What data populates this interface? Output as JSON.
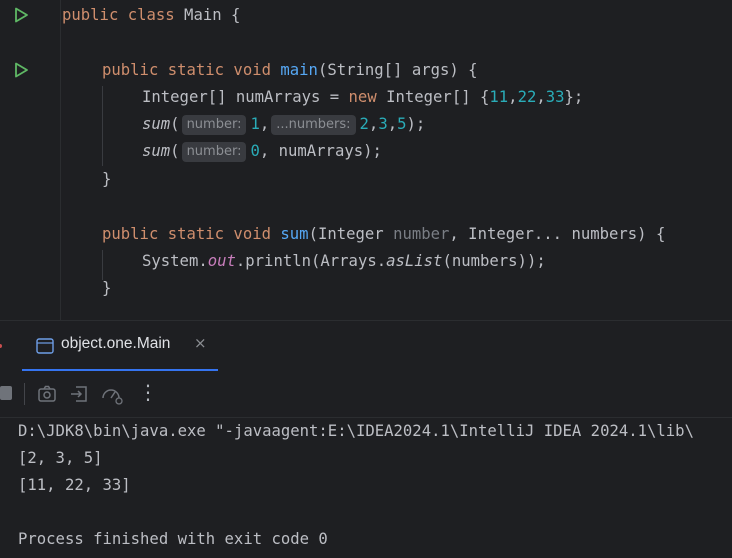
{
  "editor": {
    "line1": {
      "kw": "public class",
      "rest": " Main {"
    },
    "line3": {
      "kw": "public static void",
      "name": "main",
      "rest": "(String[] args) {"
    },
    "line4": {
      "a": "Integer[] numArrays = ",
      "kw": "new",
      "b": " Integer[] {",
      "n1": "11",
      "c1": ",",
      "n2": "22",
      "c2": ",",
      "n3": "33",
      "end": "};"
    },
    "line5": {
      "call": "sum",
      "open": "(",
      "hint1": "number:",
      "v1": "1",
      "comma": ",",
      "hint2": "...numbers:",
      "v2": "2",
      "c1": ",",
      "v3": "3",
      "c2": ",",
      "v4": "5",
      "end": ");"
    },
    "line6": {
      "call": "sum",
      "open": "(",
      "hint1": "number:",
      "v1": "0",
      "rest": ", numArrays);"
    },
    "line7": {
      "text": "}"
    },
    "line9": {
      "kw": "public static void",
      "name": "sum",
      "a": "(Integer ",
      "param": "number",
      "b": ", Integer... numbers) {"
    },
    "line10": {
      "a": "System.",
      "out": "out",
      "b": ".println(Arrays.",
      "aslist": "asList",
      "c": "(numbers));"
    },
    "line11": {
      "text": "}"
    }
  },
  "run_panel": {
    "tab_label": "object.one.Main",
    "tab_close": "×",
    "toolbar_icons": [
      "stop-icon",
      "camera-icon",
      "restore-layout-icon",
      "profiler-icon",
      "more-icon"
    ],
    "more_label": "⋮"
  },
  "console": {
    "lines": [
      "D:\\JDK8\\bin\\java.exe \"-javaagent:E:\\IDEA2024.1\\IntelliJ IDEA 2024.1\\lib\\",
      "[2, 3, 5]",
      "[11, 22, 33]",
      "",
      "Process finished with exit code 0"
    ]
  },
  "colors": {
    "background": "#1e1f22",
    "keyword": "#cf8e6d",
    "function": "#56a8f5",
    "number": "#2aacb8",
    "static_field": "#c77dbb",
    "run_icon": "#5fb865",
    "tab_underline": "#3574f0"
  }
}
